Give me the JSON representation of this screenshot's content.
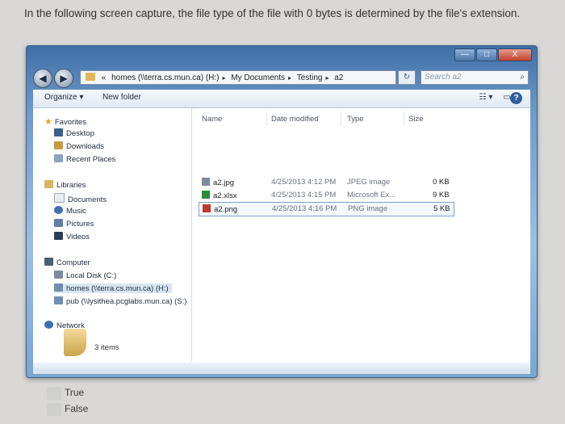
{
  "question": "In the following screen capture, the file type of the file with 0 bytes is determined by the file's extension.",
  "window": {
    "caption": {
      "min": "—",
      "max": "□",
      "close": "X"
    },
    "nav": {
      "back": "◀",
      "forward": "▶"
    },
    "address": {
      "prefix": "«",
      "crumbs": [
        "homes (\\\\terra.cs.mun.ca) (H:)",
        "My Documents",
        "Testing",
        "a2"
      ],
      "separator": "▸"
    },
    "refresh": "↻",
    "search_placeholder": "Search a2",
    "search_icon": "search-icon",
    "toolbar": {
      "organize": "Organize ▾",
      "new_folder": "New folder",
      "views": "☷ ▾",
      "preview": "▭",
      "help": "?"
    },
    "nav_pane": {
      "favorites": {
        "label": "Favorites",
        "items": [
          "Desktop",
          "Downloads",
          "Recent Places"
        ]
      },
      "libraries": {
        "label": "Libraries",
        "items": [
          "Documents",
          "Music",
          "Pictures",
          "Videos"
        ]
      },
      "computer": {
        "label": "Computer",
        "items": [
          "Local Disk (C:)",
          "homes (\\\\terra.cs.mun.ca) (H:)",
          "pub (\\\\lysithea.pcglabs.mun.ca) (S:)"
        ]
      },
      "network": {
        "label": "Network"
      }
    },
    "columns": {
      "name": "Name",
      "date": "Date modified",
      "type": "Type",
      "size": "Size"
    },
    "files": [
      {
        "name": "a2.jpg",
        "date": "4/25/2013 4:12 PM",
        "type": "JPEG image",
        "size": "0 KB",
        "icon": "jpg-file-icon",
        "color": "#7f8a99"
      },
      {
        "name": "a2.xlsx",
        "date": "4/25/2013 4:15 PM",
        "type": "Microsoft Ex...",
        "size": "9 KB",
        "icon": "excel-file-icon",
        "color": "#2f8a3c"
      },
      {
        "name": "a2.png",
        "date": "4/25/2013 4:16 PM",
        "type": "PNG image",
        "size": "5 KB",
        "icon": "png-file-icon",
        "color": "#c0392b"
      }
    ],
    "status": "3 items"
  },
  "options": [
    "True",
    "False"
  ]
}
